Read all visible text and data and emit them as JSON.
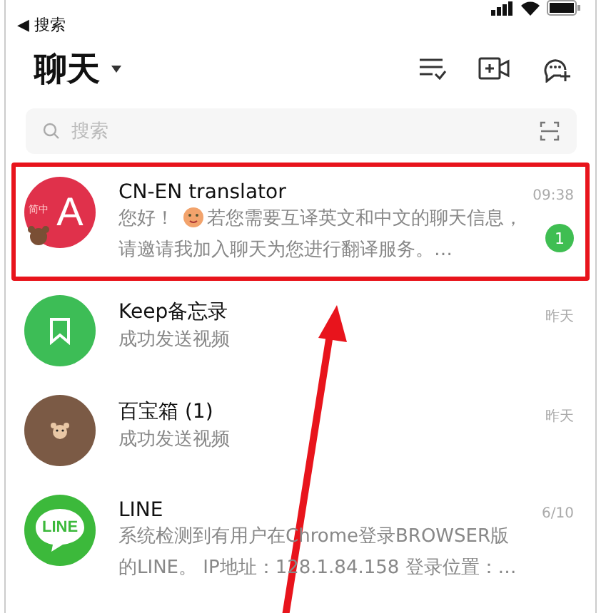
{
  "status_bar": {
    "back_label": "◀ 搜索"
  },
  "header": {
    "title": "聊天"
  },
  "search": {
    "placeholder": "搜索"
  },
  "chats": [
    {
      "kind": "translator",
      "name": "CN-EN translator",
      "avatar_letter": "A",
      "avatar_tag": "简中",
      "message": "您好！ 若您需要互译英文和中文的聊天信息，请邀请我加入聊天为您进行翻译服务。…",
      "time": "09:38",
      "unread": "1",
      "highlighted": true
    },
    {
      "kind": "keep",
      "name": "Keep备忘录",
      "message": "成功发送视频",
      "time": "昨天",
      "highlighted": false
    },
    {
      "kind": "bear",
      "name": "百宝箱 (1)",
      "message": "成功发送视频",
      "time": "昨天",
      "highlighted": false
    },
    {
      "kind": "line",
      "name": "LINE",
      "logo_text": "LINE",
      "message": "系统检测到有用户在Chrome登录BROWSER版的LINE。 IP地址：128.1.84.158 登录位置：…",
      "time": "6/10",
      "highlighted": false
    }
  ]
}
